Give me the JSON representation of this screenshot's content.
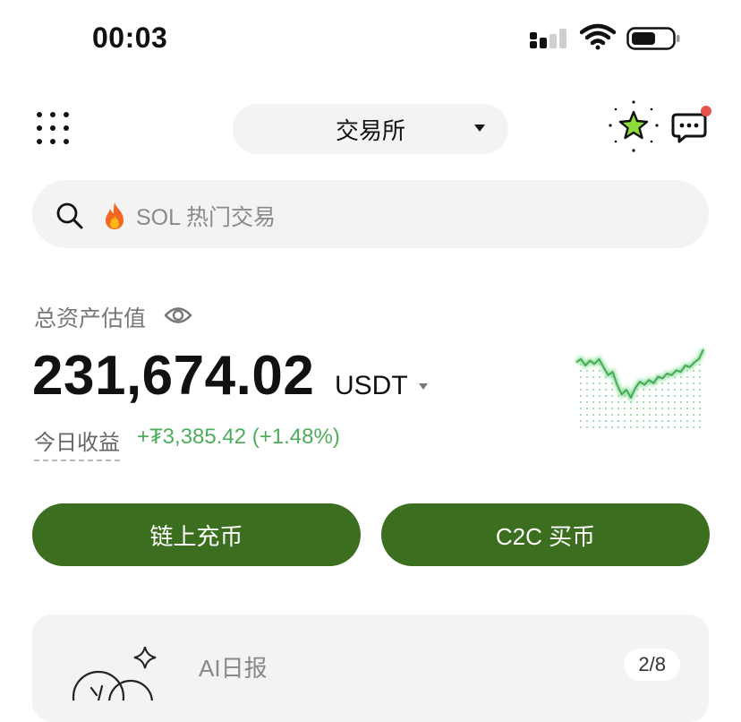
{
  "status_bar": {
    "time": "00:03"
  },
  "header": {
    "exchange_selector_label": "交易所"
  },
  "search": {
    "placeholder": "SOL 热门交易"
  },
  "assets": {
    "label": "总资产估值",
    "balance": "231,674.02",
    "currency": "USDT",
    "today_label": "今日收益",
    "today_value": "+₮3,385.42 (+1.48%)",
    "trend": [
      38,
      36,
      40,
      37,
      39,
      36,
      41,
      46,
      44,
      52,
      58,
      55,
      60,
      54,
      50,
      52,
      49,
      51,
      47,
      48,
      45,
      46,
      43,
      44,
      40,
      41,
      38,
      36,
      30
    ]
  },
  "actions": {
    "onchain_deposit_label": "链上充币",
    "c2c_buy_label": "C2C 买币"
  },
  "ai_card": {
    "title": "AI日报",
    "pager": "2/8"
  },
  "colors": {
    "primary_green": "#3c6e1f",
    "positive": "#4eae5b",
    "notification_dot": "#e5534b",
    "star": "#8edb3c"
  }
}
